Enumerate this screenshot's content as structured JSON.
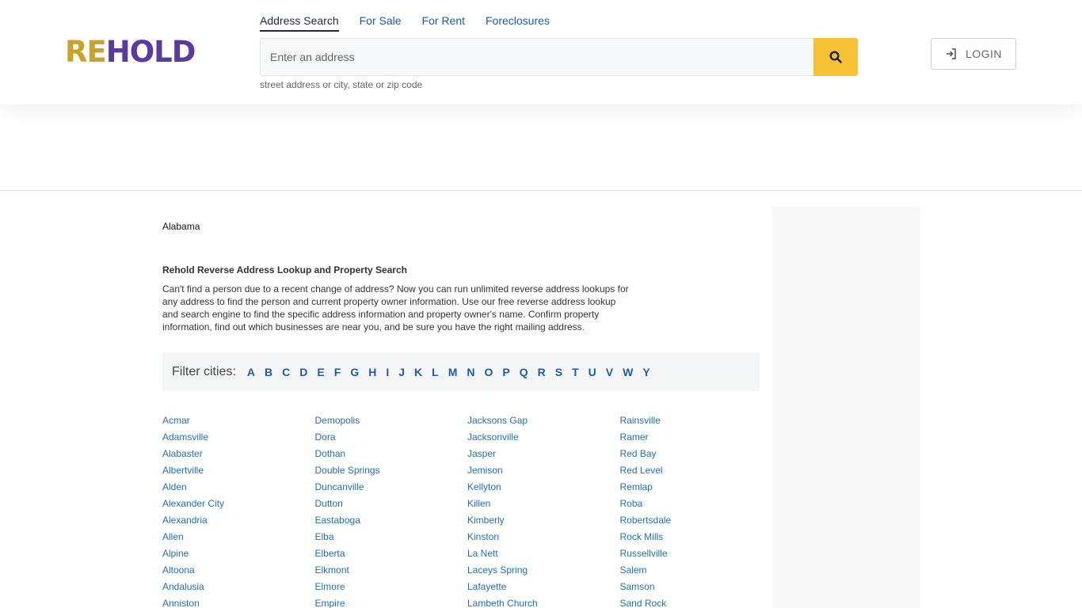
{
  "logo": {
    "part1": "RE",
    "part2": "HOLD"
  },
  "tabs": [
    {
      "label": "Address Search"
    },
    {
      "label": "For Sale"
    },
    {
      "label": "For Rent"
    },
    {
      "label": "Foreclosures"
    }
  ],
  "search": {
    "placeholder": "Enter an address",
    "value": "",
    "hint": "street address or city, state or zip code"
  },
  "login": {
    "label": "LOGIN"
  },
  "breadcrumb": {
    "state": "Alabama"
  },
  "intro": {
    "title": "Rehold Reverse Address Lookup and Property Search",
    "text": "Can't find a person due to a recent change of address? Now you can run unlimited reverse address lookups for any address to find the person and current property owner information. Use our free reverse address lookup and search engine to find the specific address information and property owner's name. Confirm property information, find out which businesses are near you, and be sure you have the right mailing address."
  },
  "filter": {
    "label": "Filter cities:",
    "letters": [
      "A",
      "B",
      "C",
      "D",
      "E",
      "F",
      "G",
      "H",
      "I",
      "J",
      "K",
      "L",
      "M",
      "N",
      "O",
      "P",
      "Q",
      "R",
      "S",
      "T",
      "U",
      "V",
      "W",
      "Y"
    ]
  },
  "cities": [
    [
      "Acmar",
      "Adamsville",
      "Alabaster",
      "Albertville",
      "Alden",
      "Alexander City",
      "Alexandria",
      "Allen",
      "Alpine",
      "Altoona",
      "Andalusia",
      "Anniston"
    ],
    [
      "Demopolis",
      "Dora",
      "Dothan",
      "Double Springs",
      "Duncanville",
      "Dutton",
      "Eastaboga",
      "Elba",
      "Elberta",
      "Elkmont",
      "Elmore",
      "Empire"
    ],
    [
      "Jacksons Gap",
      "Jacksonville",
      "Jasper",
      "Jemison",
      "Kellyton",
      "Killen",
      "Kimberly",
      "Kinston",
      "La Nett",
      "Laceys Spring",
      "Lafayette",
      "Lambeth Church"
    ],
    [
      "Rainsville",
      "Ramer",
      "Red Bay",
      "Red Level",
      "Remlap",
      "Roba",
      "Robertsdale",
      "Rock Mills",
      "Russellville",
      "Salem",
      "Samson",
      "Sand Rock"
    ]
  ],
  "colors": {
    "accent": "#f6c234",
    "link": "#1f6fb8",
    "logo_gold": "#c9a227",
    "logo_purple": "#5a3aa1"
  },
  "icons": {
    "search": "search-icon",
    "login": "login-icon"
  }
}
